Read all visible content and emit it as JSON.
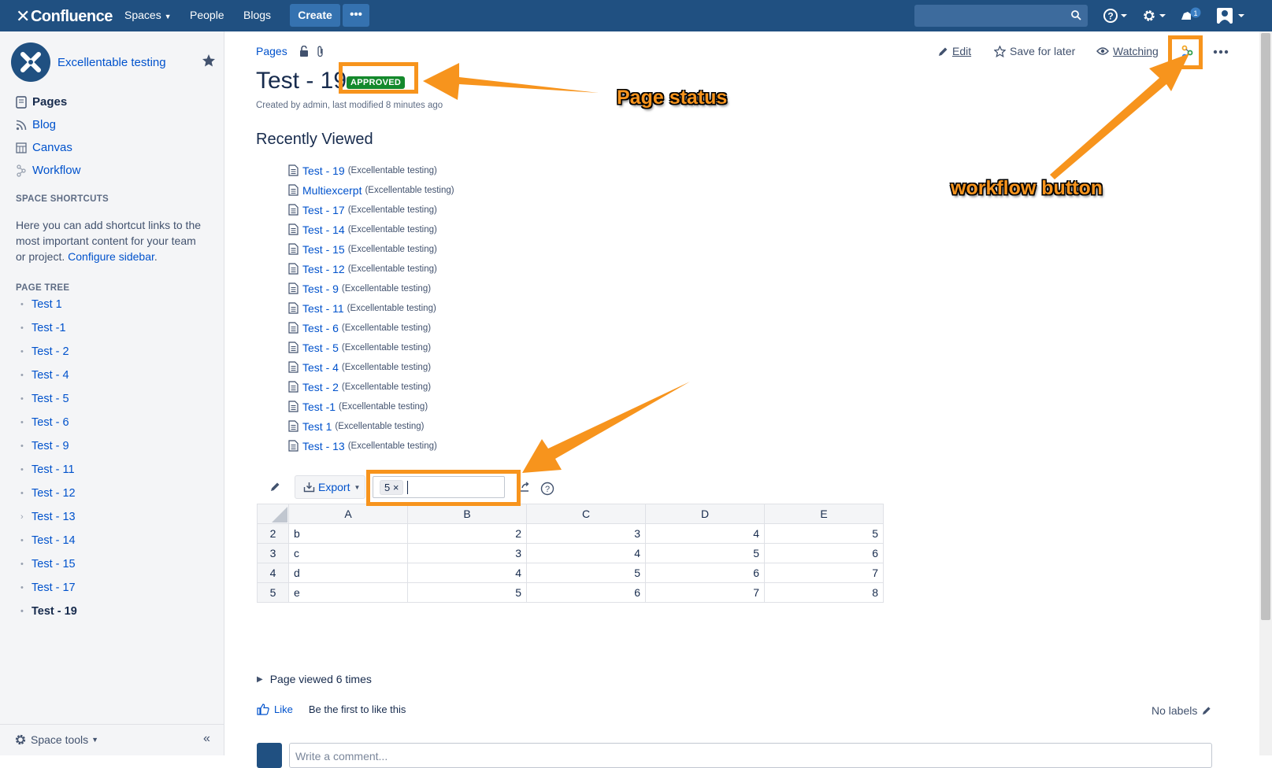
{
  "header": {
    "logo_text": "Confluence",
    "nav": {
      "spaces": "Spaces",
      "people": "People",
      "blogs": "Blogs"
    },
    "create_label": "Create",
    "more_label": "•••",
    "notification_count": "1"
  },
  "sidebar": {
    "space_name": "Excellentable testing",
    "nav": {
      "pages": "Pages",
      "blog": "Blog",
      "canvas": "Canvas",
      "workflow": "Workflow"
    },
    "shortcuts_heading": "SPACE SHORTCUTS",
    "shortcuts_text": "Here you can add shortcut links to the most important content for your team or project.",
    "configure_link": "Configure sidebar",
    "page_tree_heading": "PAGE TREE",
    "page_tree": [
      "Test 1",
      "Test -1",
      "Test - 2",
      "Test - 4",
      "Test - 5",
      "Test - 6",
      "Test - 9",
      "Test - 11",
      "Test - 12",
      "Test - 13",
      "Test - 14",
      "Test - 15",
      "Test - 17",
      "Test - 19"
    ],
    "space_tools": "Space tools"
  },
  "page": {
    "breadcrumb": "Pages",
    "title": "Test - 19",
    "status": "APPROVED",
    "meta": "Created by admin, last modified 8 minutes ago",
    "actions": {
      "edit": "Edit",
      "save_for_later": "Save for later",
      "watching": "Watching"
    }
  },
  "recently_viewed": {
    "heading": "Recently Viewed",
    "items": [
      {
        "title": "Test - 19",
        "space": "(Excellentable testing)"
      },
      {
        "title": "Multiexcerpt",
        "space": "(Excellentable testing)"
      },
      {
        "title": "Test - 17",
        "space": "(Excellentable testing)"
      },
      {
        "title": "Test - 14",
        "space": "(Excellentable testing)"
      },
      {
        "title": "Test - 15",
        "space": "(Excellentable testing)"
      },
      {
        "title": "Test - 12",
        "space": "(Excellentable testing)"
      },
      {
        "title": "Test - 9",
        "space": "(Excellentable testing)"
      },
      {
        "title": "Test - 11",
        "space": "(Excellentable testing)"
      },
      {
        "title": "Test - 6",
        "space": "(Excellentable testing)"
      },
      {
        "title": "Test - 5",
        "space": "(Excellentable testing)"
      },
      {
        "title": "Test - 4",
        "space": "(Excellentable testing)"
      },
      {
        "title": "Test - 2",
        "space": "(Excellentable testing)"
      },
      {
        "title": "Test -1",
        "space": "(Excellentable testing)"
      },
      {
        "title": "Test 1",
        "space": "(Excellentable testing)"
      },
      {
        "title": "Test - 13",
        "space": "(Excellentable testing)"
      }
    ]
  },
  "table_toolbar": {
    "export_label": "Export",
    "filter_chip": "5 ×"
  },
  "table": {
    "columns": [
      "A",
      "B",
      "C",
      "D",
      "E"
    ],
    "rows": [
      {
        "num": "2",
        "cells": [
          "b",
          "2",
          "3",
          "4",
          "5"
        ]
      },
      {
        "num": "3",
        "cells": [
          "c",
          "3",
          "4",
          "5",
          "6"
        ]
      },
      {
        "num": "4",
        "cells": [
          "d",
          "4",
          "5",
          "6",
          "7"
        ]
      },
      {
        "num": "5",
        "cells": [
          "e",
          "5",
          "6",
          "7",
          "8"
        ]
      }
    ]
  },
  "footer": {
    "views": "Page viewed 6 times",
    "like": "Like",
    "like_text": "Be the first to like this",
    "labels": "No labels",
    "comment_placeholder": "Write a comment..."
  },
  "annotations": {
    "page_status": "Page status",
    "workflow_button": "workflow button"
  },
  "colors": {
    "header": "#205081",
    "link": "#0052cc",
    "approved": "#14892c",
    "annotation": "#f7941d"
  }
}
